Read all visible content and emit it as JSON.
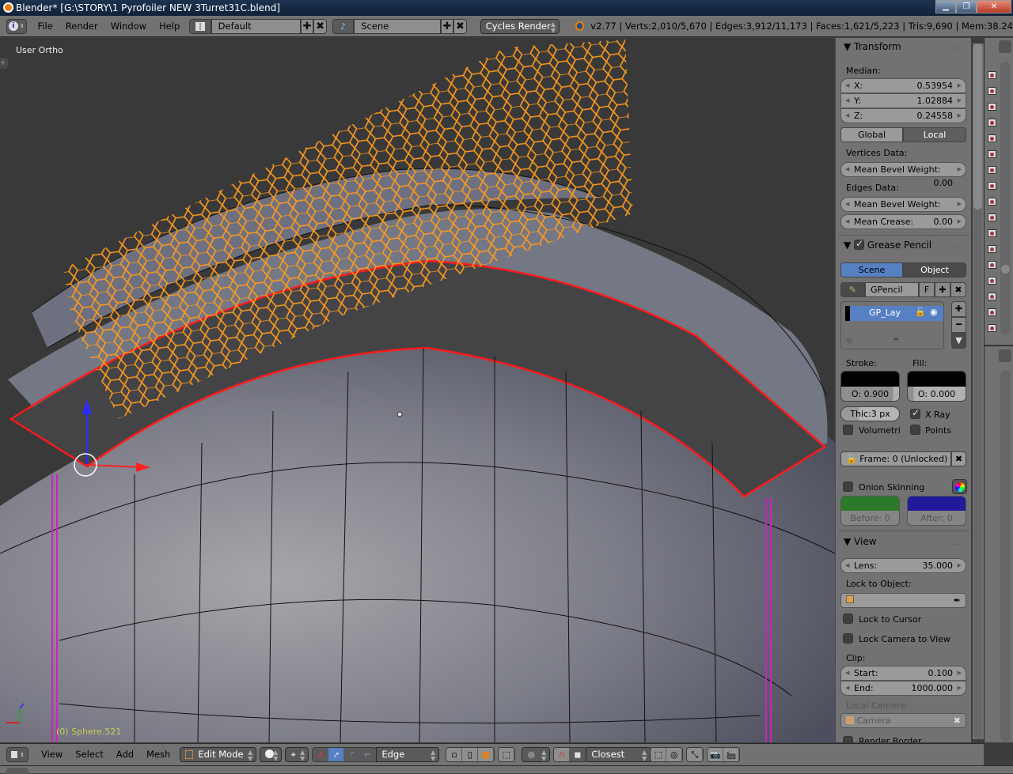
{
  "window": {
    "title": "Blender* [G:\\STORY\\1 Pyrofoiler NEW 3Turret31C.blend]",
    "controls": [
      "minimize",
      "restore",
      "close"
    ]
  },
  "topbar": {
    "editor_type_icon": "info-icon",
    "menus": [
      "File",
      "Render",
      "Window",
      "Help"
    ],
    "screen_layout": "Default",
    "scene": "Scene",
    "render_engine": "Cycles Render",
    "stats": "v2.77 | Verts:2,010/5,670 | Edges:3,912/11,173 | Faces:1,621/5,223 | Tris:9,690 | Mem:38.24"
  },
  "viewport": {
    "view_label": "User Ortho",
    "object_label": "(0) Sphere.521",
    "axis_x": "X",
    "axis_z": "Z",
    "colors": {
      "background": "#393939",
      "grease_pencil_stroke": "#ff9a1a",
      "selected_edge": "#ff1a1a",
      "seam": "#d020c0",
      "mesh_face": "#7a7c88"
    }
  },
  "npanel": {
    "transform": {
      "title": "Transform",
      "median_label": "Median:",
      "x_label": "X:",
      "x_value": "0.53954",
      "y_label": "Y:",
      "y_value": "1.02884",
      "z_label": "Z:",
      "z_value": "0.24558",
      "global_label": "Global",
      "local_label": "Local",
      "active_space": "Local",
      "vertices_data_label": "Vertices Data:",
      "vert_bevel_label": "Mean Bevel Weight:",
      "vert_bevel_value": "0.00",
      "edges_data_label": "Edges Data:",
      "edge_bevel_label": "Mean Bevel Weight:",
      "edge_bevel_value": "0.00",
      "crease_label": "Mean Crease:",
      "crease_value": "0.00"
    },
    "grease_pencil": {
      "title": "Grease Pencil",
      "enabled": true,
      "scene_label": "Scene",
      "object_label": "Object",
      "active_source": "Scene",
      "datablock_name": "GPencil",
      "fake_user": "F",
      "layer_name": "GP_Lay",
      "stroke_label": "Stroke:",
      "fill_label": "Fill:",
      "stroke_color": "#000000",
      "fill_color": "#000000",
      "stroke_opacity": "O: 0.900",
      "stroke_opacity_value": 0.9,
      "fill_opacity": "O: 0.000",
      "fill_opacity_value": 0.0,
      "thickness": "Thic:3 px",
      "xray_label": "X Ray",
      "xray": true,
      "volumetric_label": "Volumetri",
      "volumetric": false,
      "points_label": "Points",
      "points": false,
      "frame_label": "Frame: 0 (Unlocked)",
      "onion_label": "Onion Skinning",
      "onion": false,
      "before_color": "#2a7a2a",
      "after_color": "#221a9a",
      "before_label": "Before: 0",
      "after_label": "After:  0"
    },
    "view": {
      "title": "View",
      "lens_label": "Lens:",
      "lens_value": "35.000",
      "lock_object_label": "Lock to Object:",
      "lock_cursor_label": "Lock to Cursor",
      "lock_camera_label": "Lock Camera to View",
      "clip_label": "Clip:",
      "clip_start_label": "Start:",
      "clip_start_value": "0.100",
      "clip_end_label": "End:",
      "clip_end_value": "1000.000",
      "local_camera_label": "Local Camera:",
      "local_camera_placeholder": "Camera",
      "render_border_label": "Render Border"
    }
  },
  "bottombar": {
    "editor_type_icon": "3d-view-icon",
    "menus": [
      "View",
      "Select",
      "Add",
      "Mesh"
    ],
    "mode": "Edit Mode",
    "pivot_icon": "pivot-icon",
    "manipulator_active": "translate",
    "transform_orientation": "Edge",
    "select_mode": "face",
    "snap_target": "Closest"
  }
}
